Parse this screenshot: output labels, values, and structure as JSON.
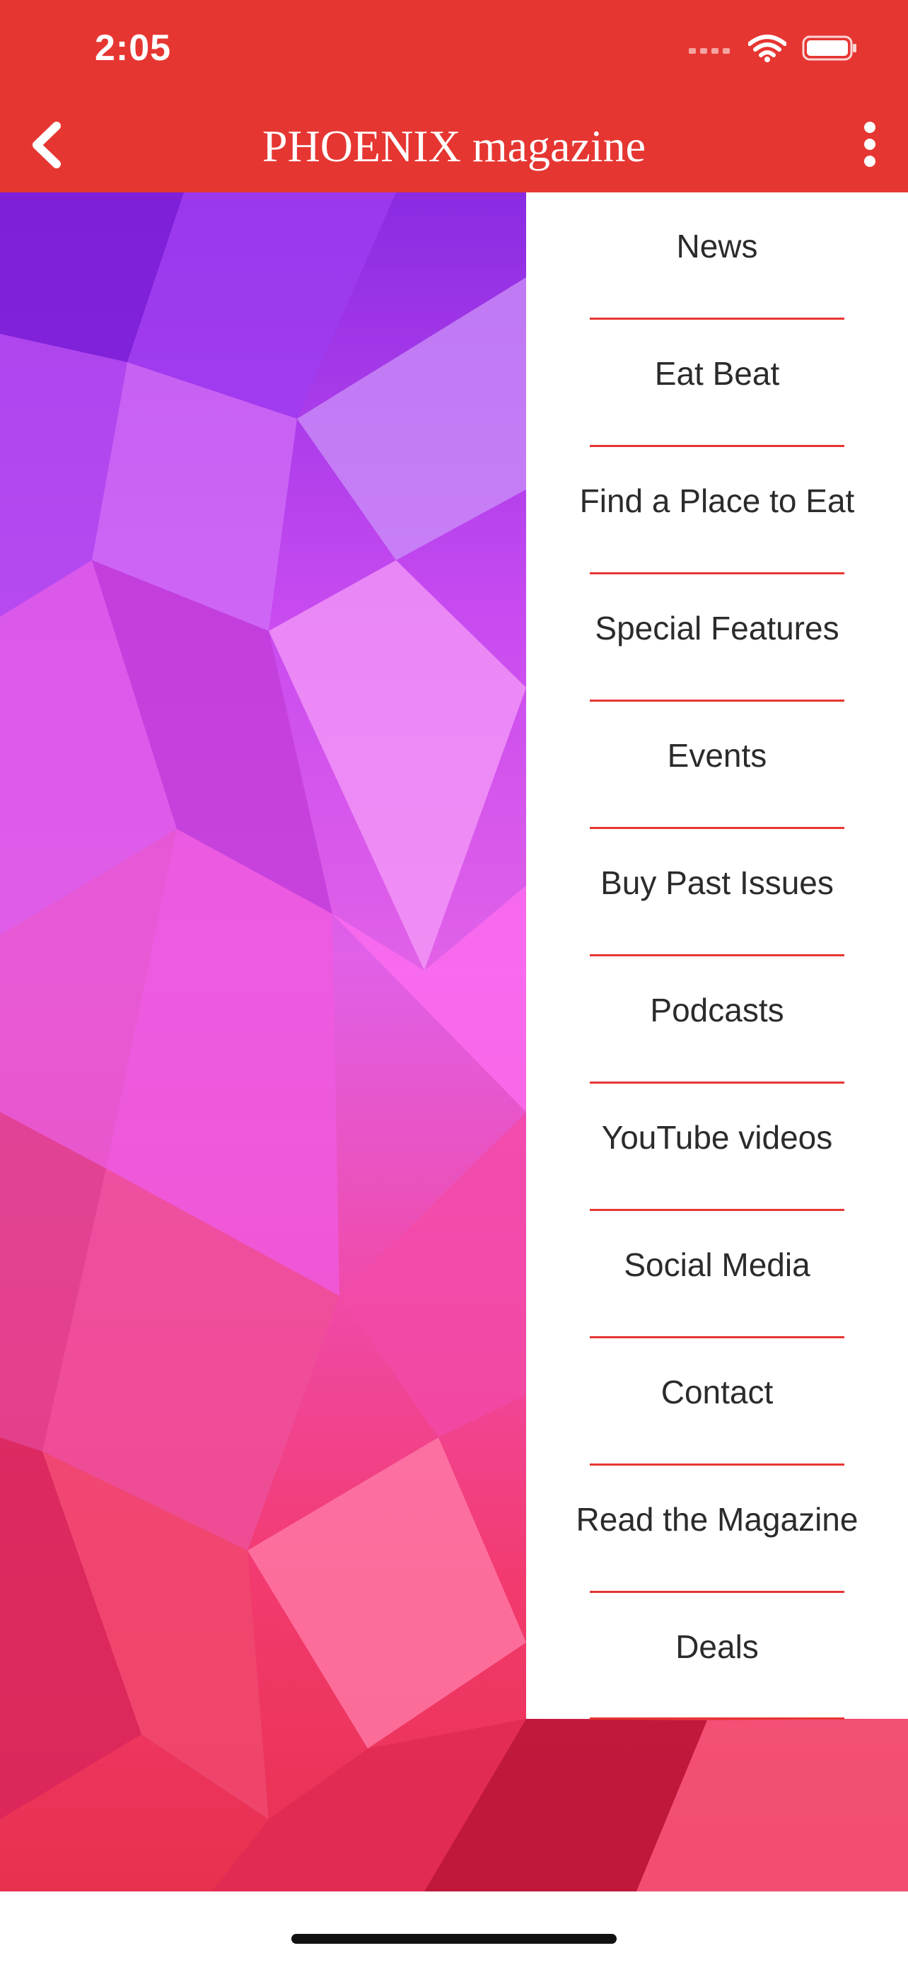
{
  "status_bar": {
    "time": "2:05"
  },
  "header": {
    "title": "PHOENIX magazine"
  },
  "menu": {
    "items": [
      {
        "label": "News"
      },
      {
        "label": "Eat Beat"
      },
      {
        "label": "Find a Place to Eat"
      },
      {
        "label": "Special Features"
      },
      {
        "label": "Events"
      },
      {
        "label": "Buy Past Issues"
      },
      {
        "label": "Podcasts"
      },
      {
        "label": "YouTube videos"
      },
      {
        "label": "Social Media"
      },
      {
        "label": "Contact"
      },
      {
        "label": "Read the Magazine"
      },
      {
        "label": "Deals"
      }
    ]
  },
  "colors": {
    "accent": "#e63632"
  }
}
